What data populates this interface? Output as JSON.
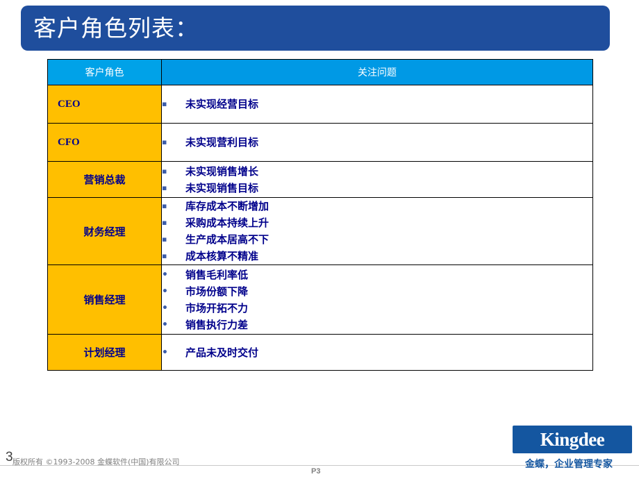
{
  "slide": {
    "title": "客户角色列表：",
    "table": {
      "headers": [
        "客户角色",
        "关注问题"
      ],
      "rows": [
        {
          "role": "CEO",
          "latin": true,
          "bullet": "square",
          "issues": [
            "未实现经营目标"
          ]
        },
        {
          "role": "CFO",
          "latin": true,
          "bullet": "square",
          "issues": [
            "未实现营利目标"
          ]
        },
        {
          "role": "营销总裁",
          "latin": false,
          "bullet": "square",
          "issues": [
            "未实现销售增长",
            "未实现销售目标"
          ]
        },
        {
          "role": "财务经理",
          "latin": false,
          "bullet": "square",
          "issues": [
            "库存成本不断增加",
            "采购成本持续上升",
            "生产成本居高不下",
            "成本核算不精准"
          ]
        },
        {
          "role": "销售经理",
          "latin": false,
          "bullet": "dot",
          "issues": [
            "销售毛利率低",
            "市场份额下降",
            "市场开拓不力",
            "销售执行力差"
          ]
        },
        {
          "role": "计划经理",
          "latin": false,
          "bullet": "dot",
          "issues": [
            "产品未及时交付"
          ]
        }
      ]
    }
  },
  "footer": {
    "page_number": "3",
    "copyright": "版权所有 ©1993-2008 金蝶软件(中国)有限公司",
    "page_code": "P3",
    "logo_text": "Kingdee",
    "logo_tagline": "金蝶，企业管理专家"
  },
  "colors": {
    "title_bar": "#1F4E9D",
    "header_cell": "#00A2E8",
    "role_cell": "#FFBF00",
    "text_navy": "#00008B",
    "logo_blue": "#1456A0"
  }
}
